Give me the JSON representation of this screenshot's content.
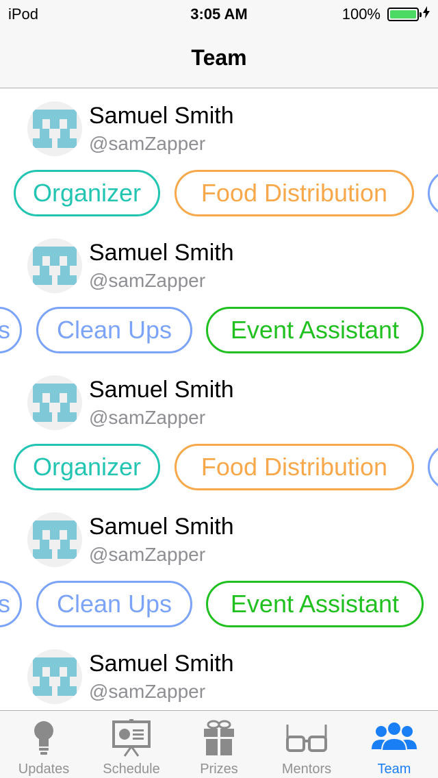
{
  "status_bar": {
    "carrier": "iPod",
    "time": "3:05 AM",
    "battery_percent": "100%",
    "battery_level": 1.0,
    "charging_icon": "lightning-icon"
  },
  "nav": {
    "title": "Team"
  },
  "members": [
    {
      "name": "Samuel Smith",
      "handle": "@samZapper"
    },
    {
      "name": "Samuel Smith",
      "handle": "@samZapper"
    },
    {
      "name": "Samuel Smith",
      "handle": "@samZapper"
    },
    {
      "name": "Samuel Smith",
      "handle": "@samZapper"
    },
    {
      "name": "Samuel Smith",
      "handle": "@samZapper"
    }
  ],
  "tag_rows": [
    {
      "tags": [
        "Organizer",
        "Food Distribution",
        ""
      ]
    },
    {
      "tags": [
        "s",
        "Clean Ups",
        "Event Assistant"
      ]
    },
    {
      "tags": [
        "Organizer",
        "Food Distribution",
        ""
      ]
    },
    {
      "tags": [
        "s",
        "Clean Ups",
        "Event Assistant"
      ]
    }
  ],
  "colors": {
    "organizer": "#22c4b2",
    "food_distribution": "#f7a84a",
    "clean_ups": "#7ba3f7",
    "event_assistant": "#20c020",
    "tab_active": "#1a7ff5",
    "tab_inactive": "#929292"
  },
  "tabs": [
    {
      "label": "Updates",
      "icon": "lightbulb-icon",
      "active": false
    },
    {
      "label": "Schedule",
      "icon": "presentation-board-icon",
      "active": false
    },
    {
      "label": "Prizes",
      "icon": "gift-icon",
      "active": false
    },
    {
      "label": "Mentors",
      "icon": "glasses-icon",
      "active": false
    },
    {
      "label": "Team",
      "icon": "people-icon",
      "active": true
    }
  ]
}
